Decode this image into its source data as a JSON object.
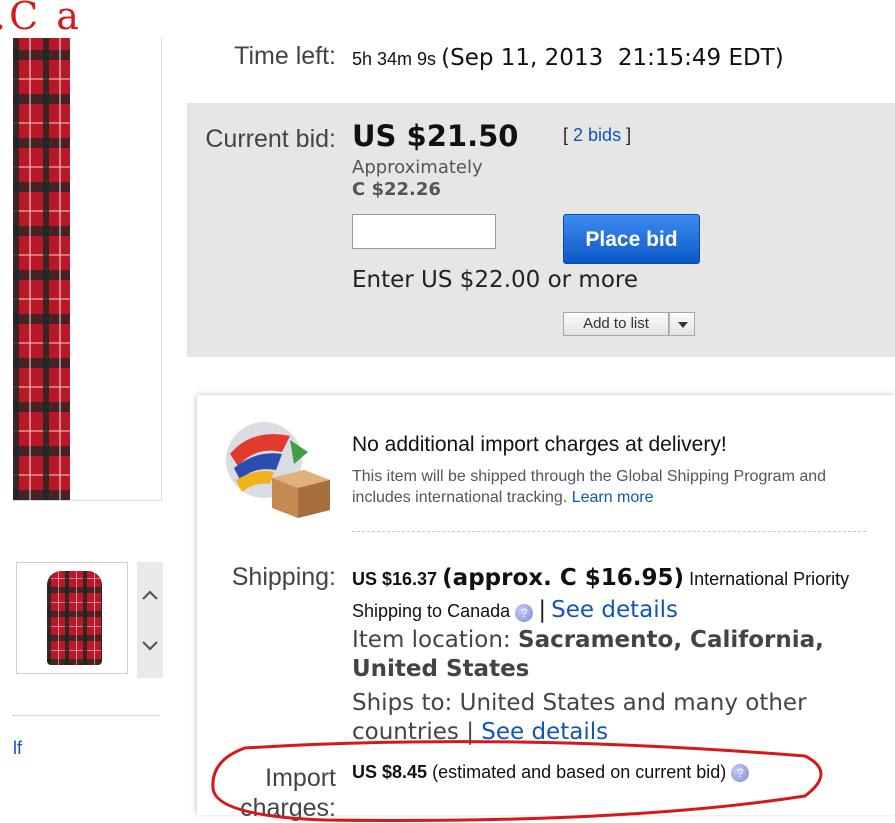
{
  "top_annotation": ".C a",
  "time_left": {
    "label": "Time left:",
    "countdown": "5h 34m 9s",
    "end_time": "(Sep 11, 2013  21:15:49 EDT)"
  },
  "bid": {
    "label": "Current bid:",
    "amount": "US $21.50",
    "bids_open": "[",
    "bids_link": "2 bids",
    "bids_close": "]",
    "approx_label": "Approximately",
    "approx_amount": "C $22.26",
    "input_value": "",
    "place_bid_label": "Place bid",
    "enter_hint": "Enter US $22.00 or more",
    "add_to_list_label": "Add to list"
  },
  "gsp": {
    "headline": "No additional import charges at delivery!",
    "description": "This item will be shipped through the Global Shipping Program and includes international tracking.",
    "learn_more": "Learn more"
  },
  "shipping": {
    "label": "Shipping:",
    "cost": "US $16.37",
    "approx": "(approx. C $16.95)",
    "service": "International Priority Shipping to Canada",
    "separator": "|",
    "see_details": "See details",
    "location_label": "Item location:",
    "location_value": "Sacramento, California, United States",
    "ships_to": "Ships to: United States and many other countries",
    "ships_separator": "|",
    "ships_see_details": "See details"
  },
  "import": {
    "label_line1": "Import",
    "label_line2": "charges:",
    "amount": "US $8.45",
    "note": "(estimated and based on current bid)"
  },
  "left_link_fragment": "lf",
  "colors": {
    "link": "#1155bb",
    "bid_panel": "#e6e6e6",
    "place_bid": "#1a63d4",
    "annotation": "#d81818"
  }
}
